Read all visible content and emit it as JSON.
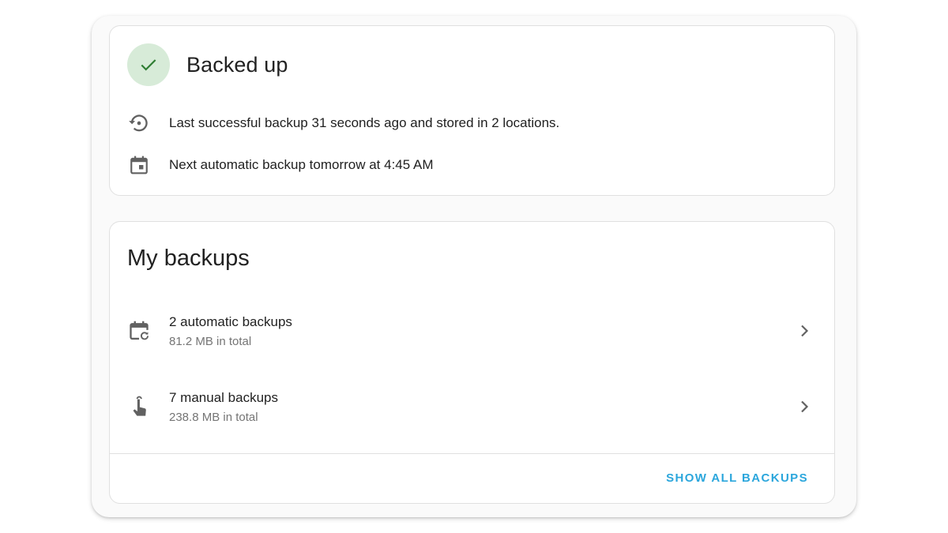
{
  "status": {
    "title": "Backed up",
    "last_backup": "Last successful backup 31 seconds ago and stored in 2 locations.",
    "next_backup": "Next automatic backup tomorrow at 4:45 AM",
    "icons": {
      "status": "check-icon",
      "last": "backup-restore-icon",
      "next": "calendar-icon"
    }
  },
  "backups": {
    "title": "My backups",
    "items": [
      {
        "label": "2 automatic backups",
        "size": "81.2 MB in total",
        "icon": "calendar-sync-icon"
      },
      {
        "label": "7 manual backups",
        "size": "238.8 MB in total",
        "icon": "gesture-tap-icon"
      }
    ],
    "show_all_label": "SHOW ALL BACKUPS"
  },
  "colors": {
    "success": "#2e7d32",
    "success_bg": "#d7ebd8",
    "accent": "#2ba6dc",
    "icon": "#616161"
  }
}
